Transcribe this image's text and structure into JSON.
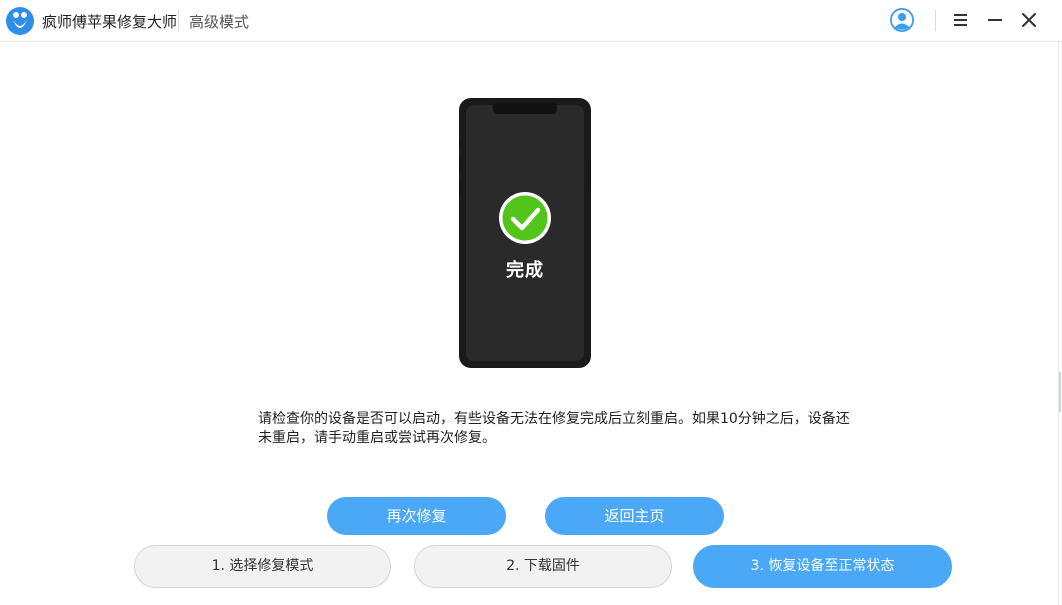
{
  "app": {
    "title": "疯师傅苹果修复大师",
    "mode": "高级模式",
    "icons": {
      "logo": "app-logo-icon",
      "user": "user-avatar-icon",
      "menu": "menu-icon",
      "minimize": "minimize-icon",
      "close": "close-icon"
    }
  },
  "status": {
    "label": "完成",
    "icon": "check-circle-icon",
    "color": "#52c41a"
  },
  "message": "请检查你的设备是否可以启动，有些设备无法在修复完成后立刻重启。如果10分钟之后，设备还未重启，请手动重启或尝试再次修复。",
  "actions": {
    "retry": "再次修复",
    "home": "返回主页"
  },
  "steps": [
    {
      "label": "1. 选择修复模式",
      "active": false
    },
    {
      "label": "2. 下载固件",
      "active": false
    },
    {
      "label": "3. 恢复设备至正常状态",
      "active": true
    }
  ],
  "colors": {
    "accent": "#4ba8f6",
    "success": "#52c41a",
    "phone": "#1a1a1a"
  }
}
